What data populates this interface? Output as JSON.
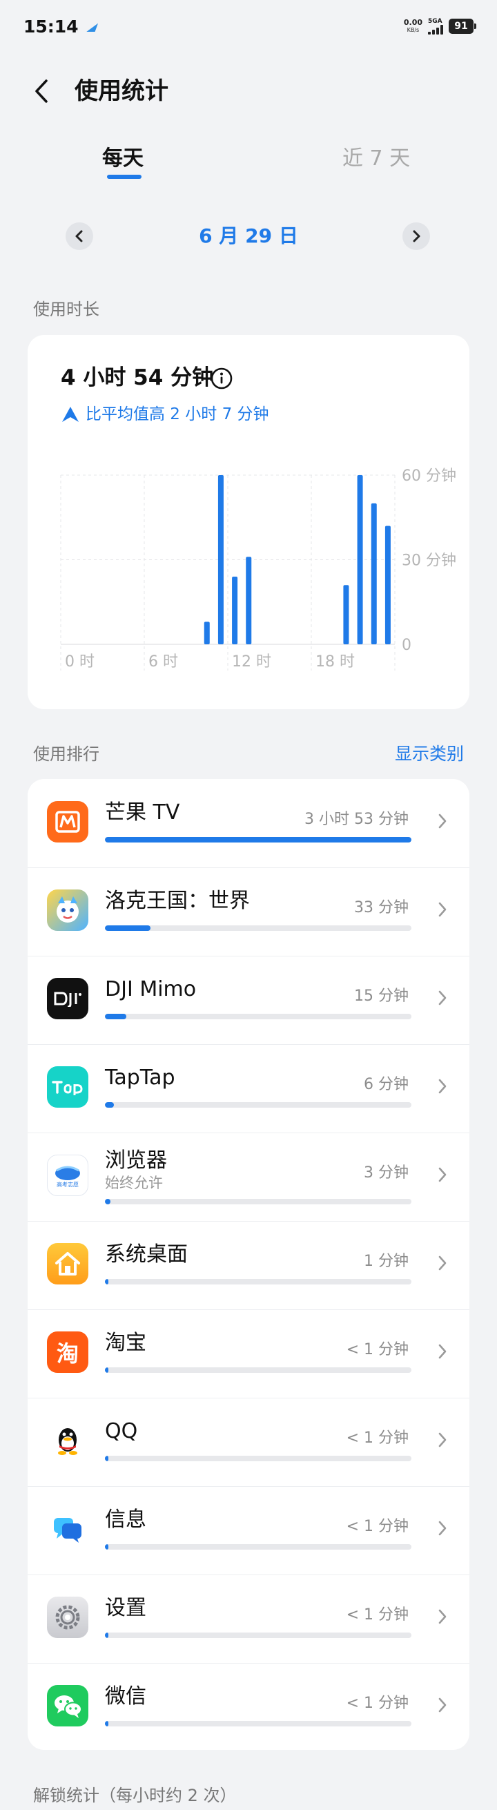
{
  "status_bar": {
    "time": "15:14",
    "net_speed_value": "0.00",
    "net_speed_unit": "KB/s",
    "network_type": "5GA",
    "battery": "91"
  },
  "header": {
    "title": "使用统计"
  },
  "tabs": [
    {
      "label": "每天",
      "active": true
    },
    {
      "label": "近 7 天",
      "active": false
    }
  ],
  "date_nav": {
    "date": "6 月 29 日"
  },
  "usage": {
    "section_label": "使用时长",
    "total": "4 小时 54 分钟",
    "compare": "比平均值高 2 小时 7 分钟"
  },
  "chart_data": {
    "type": "bar",
    "x_ticks": [
      "0 时",
      "6 时",
      "12 时",
      "18 时"
    ],
    "y_ticks": [
      "60 分钟",
      "30 分钟",
      "0"
    ],
    "ylim": [
      0,
      60
    ],
    "categories": [
      0,
      1,
      2,
      3,
      4,
      5,
      6,
      7,
      8,
      9,
      10,
      11,
      12,
      13,
      14,
      15,
      16,
      17,
      18,
      19,
      20,
      21,
      22,
      23
    ],
    "values": [
      0,
      0,
      0,
      0,
      0,
      0,
      0,
      0,
      0,
      0,
      8,
      60,
      24,
      31,
      0,
      0,
      0,
      0,
      0,
      0,
      21,
      60,
      50,
      42
    ],
    "grid": true,
    "bar_color": "#1f7ae8"
  },
  "ranking": {
    "section_label": "使用排行",
    "action_label": "显示类别",
    "apps": [
      {
        "name": "芒果 TV",
        "time": "3 小时 53 分钟",
        "fraction": 1.0,
        "icon": "mango-tv-icon"
      },
      {
        "name": "洛克王国：世界",
        "time": "33 分钟",
        "fraction": 0.148,
        "icon": "roco-kingdom-icon"
      },
      {
        "name": "DJI Mimo",
        "time": "15 分钟",
        "fraction": 0.07,
        "icon": "dji-mimo-icon"
      },
      {
        "name": "TapTap",
        "time": "6 分钟",
        "fraction": 0.03,
        "icon": "taptap-icon"
      },
      {
        "name": "浏览器",
        "sub": "始终允许",
        "time": "3 分钟",
        "fraction": 0.018,
        "icon": "browser-icon",
        "icon_text": "高考志愿"
      },
      {
        "name": "系统桌面",
        "time": "1 分钟",
        "fraction": 0.008,
        "icon": "home-launcher-icon"
      },
      {
        "name": "淘宝",
        "time": "< 1 分钟",
        "fraction": 0.006,
        "icon": "taobao-icon",
        "icon_text": "淘"
      },
      {
        "name": "QQ",
        "time": "< 1 分钟",
        "fraction": 0.006,
        "icon": "qq-icon"
      },
      {
        "name": "信息",
        "time": "< 1 分钟",
        "fraction": 0.006,
        "icon": "messages-icon"
      },
      {
        "name": "设置",
        "time": "< 1 分钟",
        "fraction": 0.006,
        "icon": "settings-icon"
      },
      {
        "name": "微信",
        "time": "< 1 分钟",
        "fraction": 0.006,
        "icon": "wechat-icon"
      }
    ]
  },
  "unlock": {
    "section_label": "解锁统计（每小时约 2 次）"
  },
  "colors": {
    "accent": "#1f7ae8",
    "background": "#f2f3f5",
    "card": "#ffffff"
  }
}
